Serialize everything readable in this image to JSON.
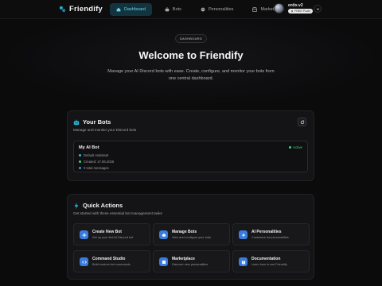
{
  "nav": {
    "brand": "Friendify",
    "links": [
      {
        "label": "Dashboard",
        "icon": "home-icon",
        "active": true
      },
      {
        "label": "Bots",
        "icon": "bot-icon",
        "active": false
      },
      {
        "label": "Personalities",
        "icon": "palette-icon",
        "active": false
      },
      {
        "label": "Marketplace",
        "icon": "store-icon",
        "active": false
      }
    ],
    "user": {
      "name": "entix.v2",
      "plan": "FREE PLAN"
    }
  },
  "hero": {
    "badge": "DASHBOARD",
    "title": "Welcome to Friendify",
    "subtitle": "Manage your AI Discord bots with ease. Create, configure, and monitor your bots from one central dashboard."
  },
  "bots": {
    "title": "Your Bots",
    "subtitle": "Manage and monitor your Discord bots",
    "items": [
      {
        "name": "My AI Bot",
        "status": "Active",
        "personality": "Default Assistant",
        "created": "Created: 17.06.2025",
        "messages": "0 total messages"
      }
    ]
  },
  "quick_actions": {
    "title": "Quick Actions",
    "subtitle": "Get started with these essential bot management tasks",
    "items": [
      {
        "title": "Create New Bot",
        "desc": "Set up your first AI Discord bot",
        "icon": "plus-icon"
      },
      {
        "title": "Manage Bots",
        "desc": "View and configure your bots",
        "icon": "bot-icon"
      },
      {
        "title": "AI Personalities",
        "desc": "Customize bot personalities",
        "icon": "sparkle-icon"
      },
      {
        "title": "Command Studio",
        "desc": "Build custom bot commands",
        "icon": "code-icon"
      },
      {
        "title": "Marketplace",
        "desc": "Discover new personalities",
        "icon": "store-icon"
      },
      {
        "title": "Documentation",
        "desc": "Learn how to use Friendify",
        "icon": "book-icon"
      }
    ]
  },
  "colors": {
    "accent": "#26b7d6",
    "active_status": "#3fd17a",
    "action_icon_bg": "#2f6fd8"
  }
}
